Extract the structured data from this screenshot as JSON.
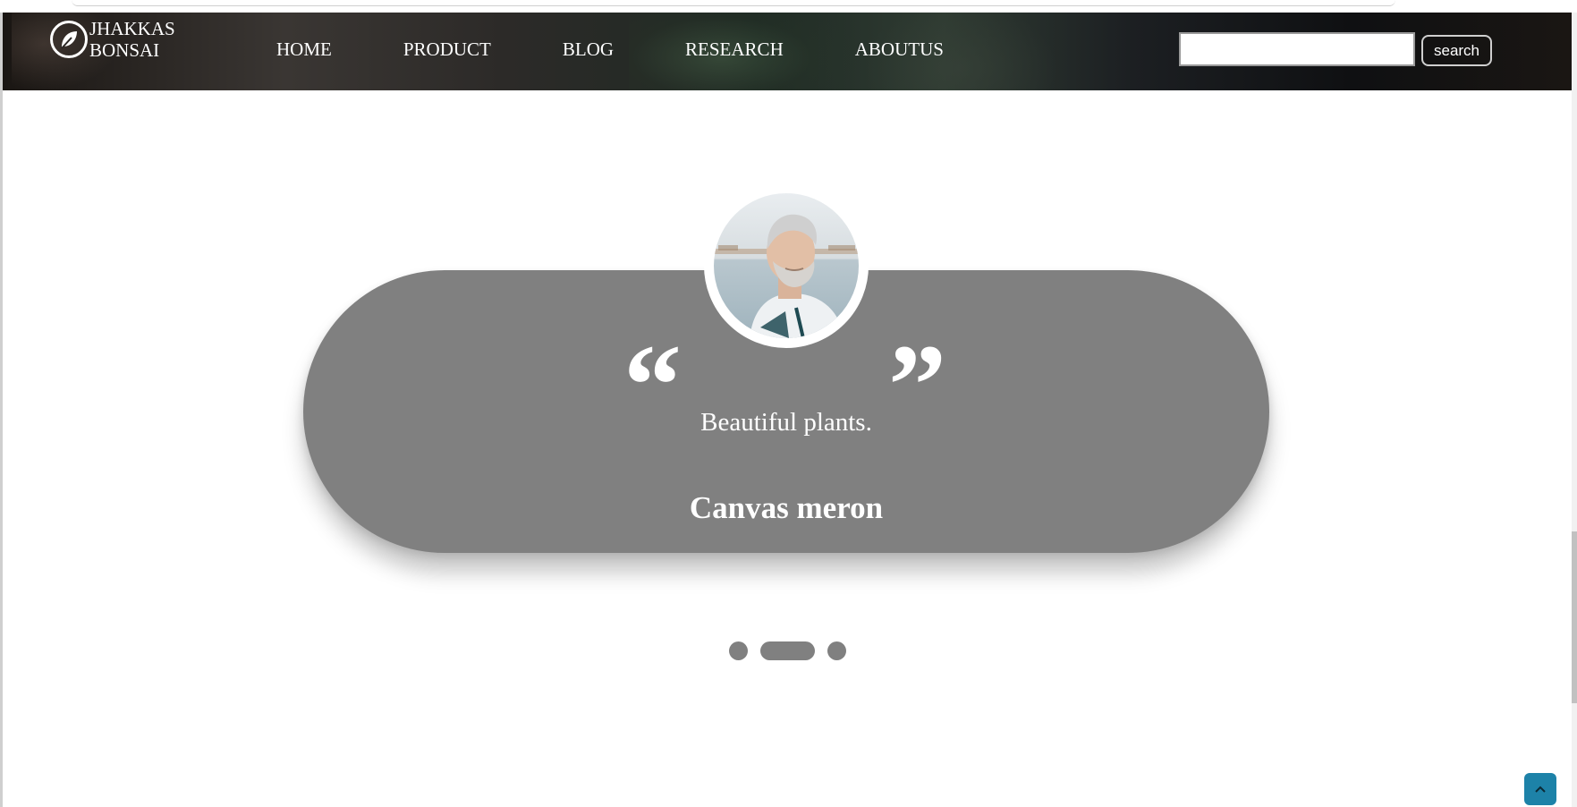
{
  "brand": {
    "line1": "JHAKKAS",
    "line2": "BONSAI",
    "icon": "leaf-icon"
  },
  "nav": {
    "items": [
      {
        "label": "HOME"
      },
      {
        "label": "PRODUCT"
      },
      {
        "label": "BLOG"
      },
      {
        "label": "RESEARCH"
      },
      {
        "label": "ABOUTUS"
      }
    ]
  },
  "search": {
    "value": "",
    "placeholder": "",
    "button_label": "search"
  },
  "testimonial": {
    "open_quote": "“",
    "close_quote": "”",
    "text": "Beautiful plants.",
    "author": "Canvas meron",
    "avatar": "person-photo",
    "slide_count": 3,
    "active_slide": 2
  },
  "scroll_top": {
    "icon": "chevron-up-icon"
  },
  "colors": {
    "card": "#808080",
    "text_on_card": "#ffffff",
    "scroll_top_button": "#1d82a8",
    "dot": "#808080"
  }
}
